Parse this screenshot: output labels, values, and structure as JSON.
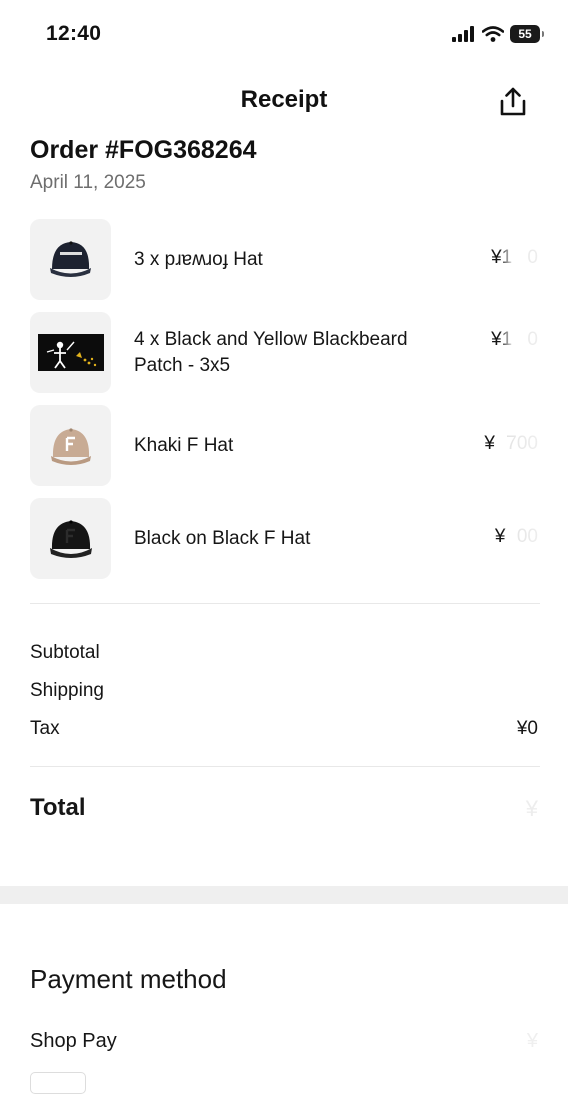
{
  "status_bar": {
    "time": "12:40",
    "battery": "55",
    "icons": [
      "cellular-signal-icon",
      "wifi-icon",
      "battery-icon"
    ]
  },
  "header": {
    "title": "Receipt",
    "share_icon": "share-icon"
  },
  "order": {
    "number": "Order #FOG368264",
    "date": "April 11, 2025"
  },
  "items": [
    {
      "name": "3 x pɹɐʍɹoɟ Hat",
      "price": "¥1    0",
      "thumbnail": "navy-cap-image"
    },
    {
      "name": "4 x Black and Yellow Blackbeard Patch - 3x5",
      "price": "¥1    0",
      "thumbnail": "blackbeard-flag-image"
    },
    {
      "name": "Khaki F Hat",
      "price": "¥   700",
      "thumbnail": "khaki-cap-image"
    },
    {
      "name": "Black on Black F Hat",
      "price": "¥   00",
      "thumbnail": "black-cap-image"
    }
  ],
  "summary": {
    "subtotal_label": "Subtotal",
    "shipping_label": "Shipping",
    "tax_label": "Tax",
    "tax_value": "¥0",
    "total_label": "Total",
    "total_value": "¥"
  },
  "payment": {
    "heading": "Payment method",
    "method_name": "Shop Pay",
    "amount": "¥"
  },
  "colors": {
    "background": "#ffffff",
    "text": "#161616",
    "muted": "#6e6e6e",
    "thumb_background": "#f2f2f2",
    "divider": "#e8e8e8"
  }
}
